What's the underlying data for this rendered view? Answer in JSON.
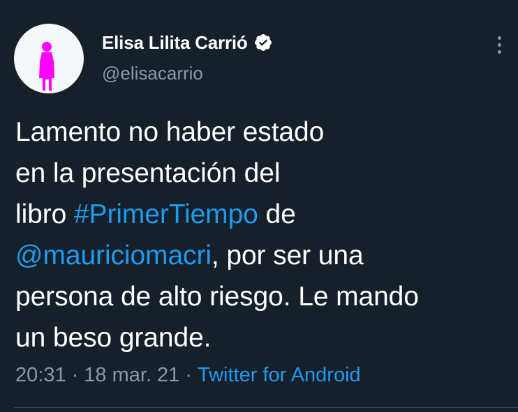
{
  "author": {
    "display_name": "Elisa Lilita Carrió",
    "handle": "@elisacarrio",
    "verified": true,
    "avatar_icon": "person-silhouette-icon"
  },
  "tweet": {
    "lines": [
      [
        {
          "text": "Lamento no haber estado",
          "type": "text"
        }
      ],
      [
        {
          "text": "en la presentación del",
          "type": "text"
        }
      ],
      [
        {
          "text": "libro ",
          "type": "text"
        },
        {
          "text": "#PrimerTiempo",
          "type": "hashtag"
        },
        {
          "text": " de",
          "type": "text"
        }
      ],
      [
        {
          "text": "@mauriciomacri",
          "type": "mention"
        },
        {
          "text": ", por ser una",
          "type": "text"
        }
      ],
      [
        {
          "text": "persona de alto riesgo. Le mando",
          "type": "text"
        }
      ],
      [
        {
          "text": "un beso grande.",
          "type": "text"
        }
      ]
    ]
  },
  "meta": {
    "time": "20:31",
    "separator": "·",
    "date": "18 mar. 21",
    "source": "Twitter for Android"
  },
  "colors": {
    "background": "#15202b",
    "link": "#1d9bf0",
    "secondary_text": "#8b98a5",
    "avatar_figure": "#ff00ff"
  }
}
